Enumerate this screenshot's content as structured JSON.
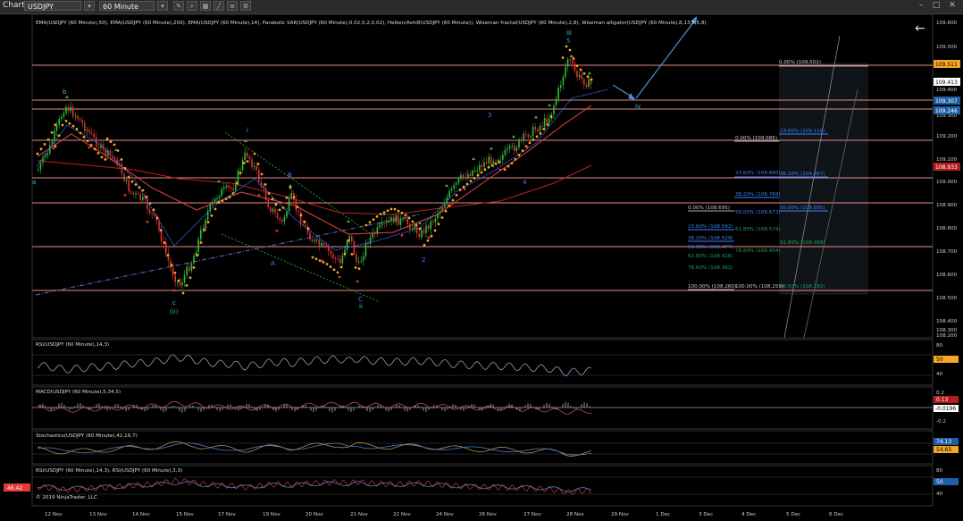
{
  "window": {
    "title": "Chart",
    "instrument": "USDJPY",
    "interval": "60 Minute",
    "copyright": "© 2019 NinjaTrader, LLC"
  },
  "indicators_header": "EMA(USDJPY (60 Minute),50), EMA(USDJPY (60 Minute),200), EMA(USDJPY (60 Minute),14), Parabolic SAR(USDJPY (60 Minute),0.02,0.2,0.02), Heiken/Ashi8(USDJPY (60 Minute)), Wiseman fractal(USDJPY (60 Minute),2,8), Wiseman alligator(USDJPY (60 Minute),8,13,5,5,8)",
  "price_axis": {
    "ticks": [
      "109.600",
      "109.500",
      "109.400",
      "109.300",
      "109.200",
      "109.100",
      "109.000",
      "108.900",
      "108.800",
      "108.700",
      "108.600",
      "108.500",
      "108.400",
      "108.300",
      "108.200"
    ],
    "flags": [
      {
        "label": "109.511",
        "color": "#f5a623",
        "text_color": "#000"
      },
      {
        "label": "109.413",
        "color": "#ffffff",
        "text_color": "#000"
      },
      {
        "label": "109.307",
        "color": "#1f5fa8",
        "text_color": "#fff"
      },
      {
        "label": "109.246",
        "color": "#1f5fa8",
        "text_color": "#fff"
      },
      {
        "label": "108.933",
        "color": "#b71c1c",
        "text_color": "#fff"
      }
    ]
  },
  "wave_labels": [
    {
      "text": "b",
      "color": "#2ec4e8"
    },
    {
      "text": "a",
      "color": "#2ec4e8"
    },
    {
      "text": "c",
      "color": "#2ec4e8"
    },
    {
      "text": "(ii)",
      "color": "#22c55e"
    },
    {
      "text": "i",
      "color": "#2ec4e8"
    },
    {
      "text": "B",
      "color": "#3b82f6"
    },
    {
      "text": "A",
      "color": "#3b82f6"
    },
    {
      "text": "C",
      "color": "#3b82f6"
    },
    {
      "text": "ii",
      "color": "#2ec4e8"
    },
    {
      "text": "2",
      "color": "#3b82f6"
    },
    {
      "text": "3",
      "color": "#3b82f6"
    },
    {
      "text": "4",
      "color": "#3b82f6"
    },
    {
      "text": "5",
      "color": "#3b82f6"
    },
    {
      "text": "iii",
      "color": "#2ec4e8"
    },
    {
      "text": "iv",
      "color": "#2ec4e8"
    }
  ],
  "fib_levels": [
    {
      "text": "0.00% (109.502)",
      "color": "#cccccc"
    },
    {
      "text": "23.60% (109.119)",
      "color": "#3b82f6"
    },
    {
      "text": "0.00% (109.085)",
      "color": "#cccccc"
    },
    {
      "text": "23.60% (108.890)",
      "color": "#3b82f6"
    },
    {
      "text": "38.20% (108.887)",
      "color": "#3b82f6"
    },
    {
      "text": "38.20% (108.769)",
      "color": "#3b82f6"
    },
    {
      "text": "0.00% (108.695)",
      "color": "#cccccc"
    },
    {
      "text": "50.00% (108.672)",
      "color": "#3b82f6"
    },
    {
      "text": "50.00% (108.695)",
      "color": "#3b82f6"
    },
    {
      "text": "23.60% (108.592)",
      "color": "#3b82f6"
    },
    {
      "text": "61.80% (108.574)",
      "color": "#22a05a"
    },
    {
      "text": "38.20% (108.529)",
      "color": "#3b82f6"
    },
    {
      "text": "61.80% (108.499)",
      "color": "#22a05a"
    },
    {
      "text": "50.00% (108.477)",
      "color": "#3b82f6"
    },
    {
      "text": "78.60% (108.454)",
      "color": "#22a05a"
    },
    {
      "text": "61.80% (108.426)",
      "color": "#22a05a"
    },
    {
      "text": "78.60% (108.362)",
      "color": "#22a05a"
    },
    {
      "text": "100.00% (108.260)",
      "color": "#cccccc"
    },
    {
      "text": "100.00% (108.259)",
      "color": "#cccccc"
    },
    {
      "text": "78.60% (108.282)",
      "color": "#22a05a"
    }
  ],
  "panels": [
    {
      "title": "RSI(USDJPY (60 Minute),14,3)",
      "ticks": [
        "80",
        "40"
      ],
      "flag": "50",
      "flag_color": "#f5a623"
    },
    {
      "title": "MACD(USDJPY (60 Minute),5,34,5)",
      "ticks": [
        "0.2",
        "-0.2"
      ],
      "flag": "0.13",
      "flag2": "-0.0196",
      "flag_color": "#b71c1c"
    },
    {
      "title": "Stochastics(USDJPY (60 Minute),42,16,7)",
      "ticks": [],
      "flag": "74.13",
      "flag2": "54.65",
      "flag_color": "#1f5fa8"
    },
    {
      "title": "RSI(USDJPY (60 Minute),14,3), RSI(USDJPY (60 Minute),3,3)",
      "ticks": [
        "80",
        "40"
      ],
      "flag": "50",
      "flag_color": "#1f5fa8",
      "left_flag": "46.42"
    }
  ],
  "x_axis": [
    "12 Nov",
    "13 Nov",
    "14 Nov",
    "15 Nov",
    "17 Nov",
    "19 Nov",
    "20 Nov",
    "21 Nov",
    "22 Nov",
    "24 Nov",
    "26 Nov",
    "27 Nov",
    "28 Nov",
    "29 Nov",
    "1 Dec",
    "3 Dec",
    "4 Dec",
    "5 Dec",
    "6 Dec"
  ]
}
